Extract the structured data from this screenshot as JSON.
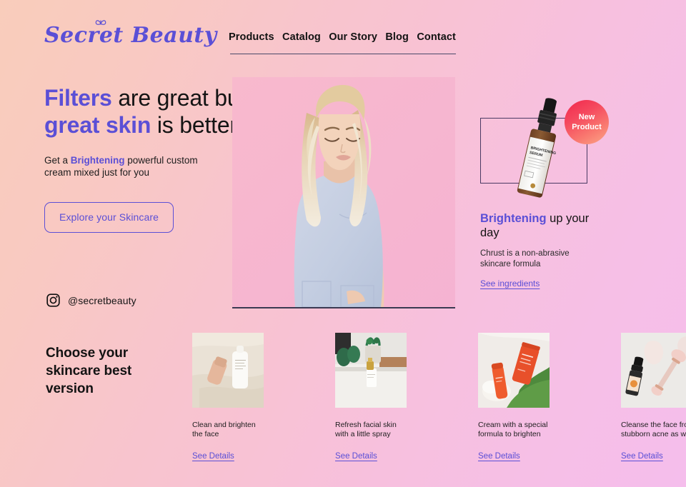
{
  "brand": {
    "name": "Secret Beauty",
    "logo_icon": "butterfly-icon",
    "accent_color": "#5b4fd6"
  },
  "nav": {
    "items": [
      {
        "label": "Products"
      },
      {
        "label": "Catalog"
      },
      {
        "label": "Our Story"
      },
      {
        "label": "Blog"
      },
      {
        "label": "Contact"
      }
    ]
  },
  "hero": {
    "heading_part1": "Filters",
    "heading_part2": " are great but ",
    "heading_part3": "great skin",
    "heading_part4": " is better",
    "sub_part1": "Get a ",
    "sub_accent": "Brightening",
    "sub_part2": " powerful custom cream mixed just for you",
    "cta_label": "Explore your Skincare",
    "social_icon": "instagram-icon",
    "social_handle": "@secretbeauty",
    "model_alt": "blonde-model-photo"
  },
  "product": {
    "badge_line1": "New",
    "badge_line2": "Product",
    "badge_color": "#f0274c",
    "bottle_label": "BRIGHTENING SERUM",
    "title_accent": "Brightening",
    "title_rest": " up your day",
    "description": "Chrust is a non-abrasive skincare formula",
    "link_label": "See ingredients"
  },
  "choose": {
    "heading": "Choose your skincare best version",
    "cards": [
      {
        "image_name": "cream-bottles-on-fabric-photo",
        "text": "Clean and brighten the face",
        "link_label": "See Details"
      },
      {
        "image_name": "spray-bottle-bathroom-photo",
        "text": "Refresh facial skin with a little spray",
        "link_label": "See Details"
      },
      {
        "image_name": "orange-tubes-with-leaves-photo",
        "text": "Cream with a special formula to brighten",
        "link_label": "See Details"
      },
      {
        "image_name": "gua-sha-roller-serum-photo",
        "text": "Cleanse the face from stubborn acne as well",
        "link_label": "See Details"
      }
    ]
  }
}
